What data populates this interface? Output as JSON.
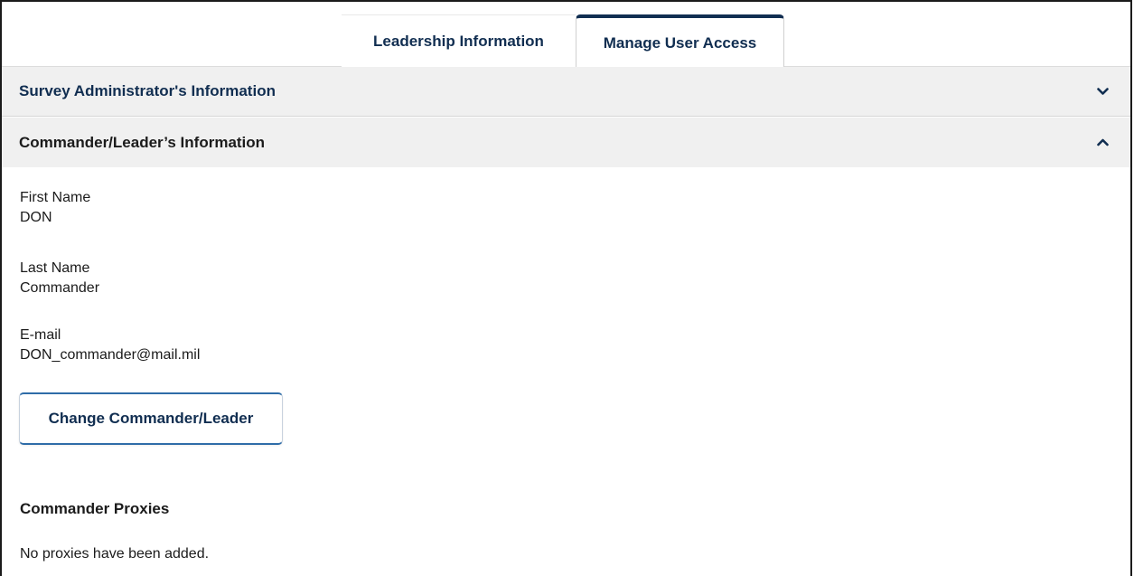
{
  "tabs": [
    {
      "label": "Leadership Information",
      "active": false
    },
    {
      "label": "Manage User Access",
      "active": true
    }
  ],
  "accordions": {
    "survey_admin": {
      "title": "Survey Administrator's Information",
      "expanded": false,
      "icon": "chevron-down-icon"
    },
    "commander": {
      "title": "Commander/Leader’s Information",
      "expanded": true,
      "icon": "chevron-up-icon"
    }
  },
  "commander": {
    "first_name_label": "First Name",
    "first_name_value": "DON",
    "last_name_label": "Last Name",
    "last_name_value": "Commander",
    "email_label": "E-mail",
    "email_value": "DON_commander@mail.mil",
    "change_button_label": "Change Commander/Leader"
  },
  "proxies": {
    "title": "Commander Proxies",
    "empty_message": "No proxies have been added."
  },
  "colors": {
    "brand_navy": "#112e51",
    "header_bg": "#f0f0f0",
    "button_accent": "#2e6ca8"
  }
}
